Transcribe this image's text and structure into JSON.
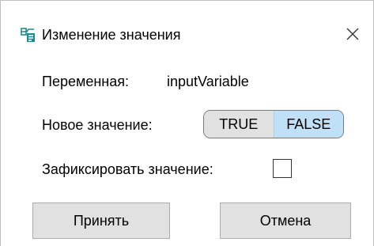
{
  "window": {
    "title": "Изменение значения",
    "icon": "variable-edit-icon",
    "close_icon": "close-icon"
  },
  "variable": {
    "label": "Переменная:",
    "name": "inputVariable"
  },
  "new_value": {
    "label": "Новое значение:",
    "options": [
      "TRUE",
      "FALSE"
    ],
    "selected": "FALSE"
  },
  "fix_value": {
    "label": "Зафиксировать значение:",
    "checked": false
  },
  "buttons": {
    "accept_label": "Принять",
    "cancel_label": "Отмена"
  },
  "colors": {
    "selected_option": "#bfe0f7",
    "button_face": "#e1e1e1"
  }
}
